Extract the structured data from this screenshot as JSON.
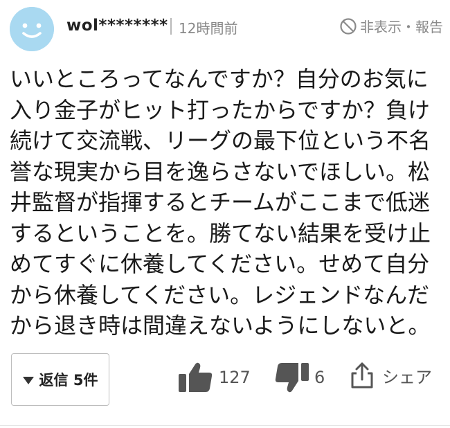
{
  "comment": {
    "username": "wol********",
    "timestamp": "12時間前",
    "report_label": "非表示・報告",
    "body": "いいところってなんですか？自分のお気に入り金子がヒット打ったからですか？負け続けて交流戦、リーグの最下位という不名誉な現実から目を逸らさないでほしい。松井監督が指揮するとチームがここまで低迷するということを。勝てない結果を受け止めてすぐに休養してください。せめて自分から休養してください。レジェンドなんだから退き時は間違えないようにしないと。",
    "reply_button_label": "返信 5件",
    "like_count": "127",
    "dislike_count": "6",
    "share_label": "シェア"
  },
  "icons": {
    "avatar": "smiley-avatar",
    "report": "prohibited-icon",
    "like": "thumbs-up-icon",
    "dislike": "thumbs-down-icon",
    "share": "share-icon",
    "reply": "caret-down-icon"
  },
  "colors": {
    "avatar_bg": "#a9d9f1",
    "text": "#1a1a1a",
    "muted": "#888888",
    "icon": "#555555"
  }
}
